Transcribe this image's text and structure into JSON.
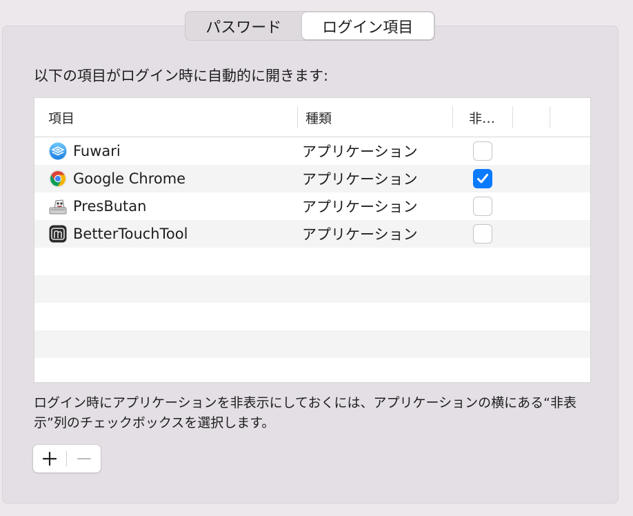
{
  "tabs": [
    {
      "label": "パスワード",
      "selected": false
    },
    {
      "label": "ログイン項目",
      "selected": true
    }
  ],
  "intro_text": "以下の項目がログイン時に自動的に開きます:",
  "table": {
    "columns": [
      "項目",
      "種類",
      "非…"
    ],
    "rows": [
      {
        "name": "Fuwari",
        "kind": "アプリケーション",
        "hidden": false,
        "icon": "fuwari-icon"
      },
      {
        "name": "Google Chrome",
        "kind": "アプリケーション",
        "hidden": true,
        "icon": "chrome-icon"
      },
      {
        "name": "PresButan",
        "kind": "アプリケーション",
        "hidden": false,
        "icon": "presbutan-icon"
      },
      {
        "name": "BetterTouchTool",
        "kind": "アプリケーション",
        "hidden": false,
        "icon": "bettertouchtool-icon"
      }
    ]
  },
  "help_text": "ログイン時にアプリケーションを非表示にしておくには、アプリケーションの横にある“非表示”列のチェックボックスを選択します。",
  "buttons": {
    "add": "+",
    "remove": "−"
  },
  "colors": {
    "accent": "#0a7aff",
    "window_bg": "#ece8ec",
    "panel_bg": "#e4dfe4"
  }
}
